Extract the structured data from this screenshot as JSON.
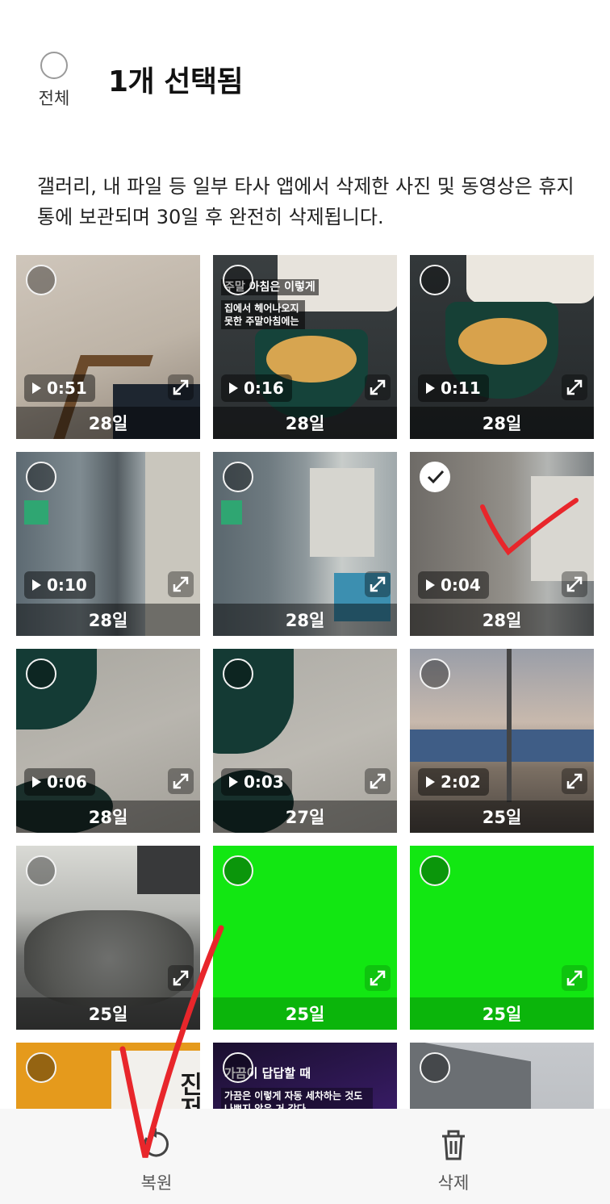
{
  "header": {
    "select_all_label": "전체",
    "title": "1개 선택됨"
  },
  "notice": "갤러리, 내 파일 등 일부 타사 앱에서 삭제한 사진 및 동영상은 휴지통에 보관되며 30일 후 완전히 삭제됩니다.",
  "items": [
    {
      "duration": "0:51",
      "days": "28일",
      "selected": false
    },
    {
      "duration": "0:16",
      "days": "28일",
      "selected": false,
      "overlay_title": "주말 아침은 이렇게",
      "overlay_sub": "집에서 헤어나오지 못한 주말아침에는"
    },
    {
      "duration": "0:11",
      "days": "28일",
      "selected": false
    },
    {
      "duration": "0:10",
      "days": "28일",
      "selected": false
    },
    {
      "duration": "",
      "days": "28일",
      "selected": false
    },
    {
      "duration": "0:04",
      "days": "28일",
      "selected": true
    },
    {
      "duration": "0:06",
      "days": "28일",
      "selected": false
    },
    {
      "duration": "0:03",
      "days": "27일",
      "selected": false
    },
    {
      "duration": "2:02",
      "days": "25일",
      "selected": false
    },
    {
      "duration": "",
      "days": "25일",
      "selected": false
    },
    {
      "duration": "",
      "days": "25일",
      "selected": false
    },
    {
      "duration": "",
      "days": "25일",
      "selected": false
    },
    {
      "duration": "",
      "days": "",
      "selected": false,
      "overlay_book": "진저맨"
    },
    {
      "duration": "",
      "days": "",
      "selected": false,
      "overlay_title": "가끔이 답답할 때",
      "overlay_sub": "가끔은 이렇게 자동 세차하는 것도 나쁘지 않은 거 같다."
    },
    {
      "duration": "",
      "days": "",
      "selected": false
    }
  ],
  "colors": {
    "accent_green": "#12e712",
    "annotation_red": "#e8262b"
  },
  "bottom_bar": {
    "restore_label": "복원",
    "delete_label": "삭제"
  }
}
